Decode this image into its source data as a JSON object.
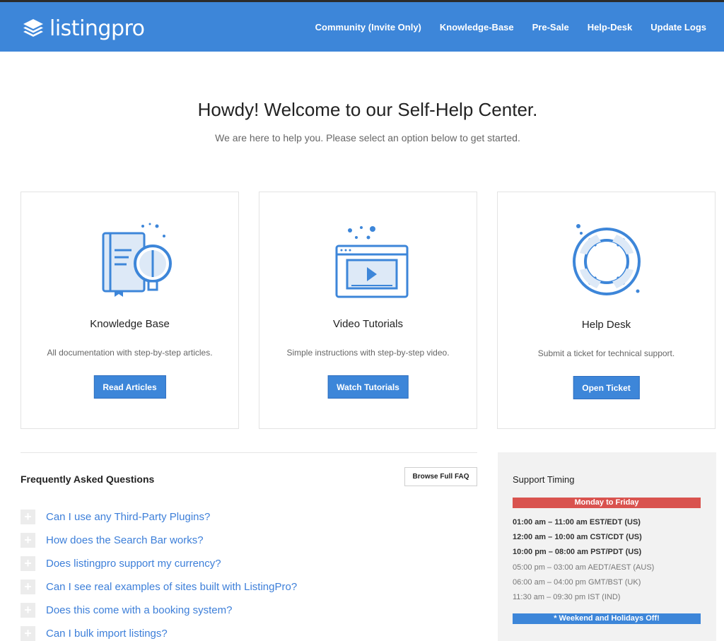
{
  "header": {
    "logo_text": "listingpro",
    "nav": [
      "Community (Invite Only)",
      "Knowledge-Base",
      "Pre-Sale",
      "Help-Desk",
      "Update Logs"
    ]
  },
  "hero": {
    "title": "Howdy! Welcome to our Self-Help Center.",
    "subtitle": "We are here to help you. Please select an option below to get started."
  },
  "cards": [
    {
      "title": "Knowledge Base",
      "desc": "All documentation with step-by-step articles.",
      "button": "Read Articles",
      "icon": "book-magnifier-icon"
    },
    {
      "title": "Video Tutorials",
      "desc": "Simple instructions with step-by-step video.",
      "button": "Watch Tutorials",
      "icon": "video-player-icon"
    },
    {
      "title": "Help Desk",
      "desc": "Submit a ticket for technical support.",
      "button": "Open Ticket",
      "icon": "lifebuoy-icon"
    }
  ],
  "faq": {
    "title": "Frequently Asked Questions",
    "browse_button": "Browse Full FAQ",
    "questions": [
      "Can I use any Third-Party Plugins?",
      "How does the Search Bar works?",
      "Does listingpro support my currency?",
      "Can I see real examples of sites built with ListingPro?",
      "Does this come with a booking system?",
      "Can I bulk import listings?"
    ]
  },
  "support": {
    "title": "Support Timing",
    "days_label": "Monday to Friday",
    "times": [
      {
        "text": "01:00 am – 11:00 am EST/EDT (US)",
        "bold": true
      },
      {
        "text": "12:00 am – 10:00 am CST/CDT (US)",
        "bold": true
      },
      {
        "text": "10:00 pm – 08:00 am PST/PDT (US)",
        "bold": true
      },
      {
        "text": "05:00 pm – 03:00 am AEDT/AEST (AUS)",
        "bold": false
      },
      {
        "text": "06:00 am – 04:00 pm GMT/BST (UK)",
        "bold": false
      },
      {
        "text": "11:30 am – 09:30 pm IST (IND)",
        "bold": false
      }
    ],
    "footer_label": "* Weekend and Holidays Off!"
  },
  "colors": {
    "brand_blue": "#3d86d9",
    "link_blue": "#3d7fd9",
    "alert_red": "#d9534f"
  }
}
